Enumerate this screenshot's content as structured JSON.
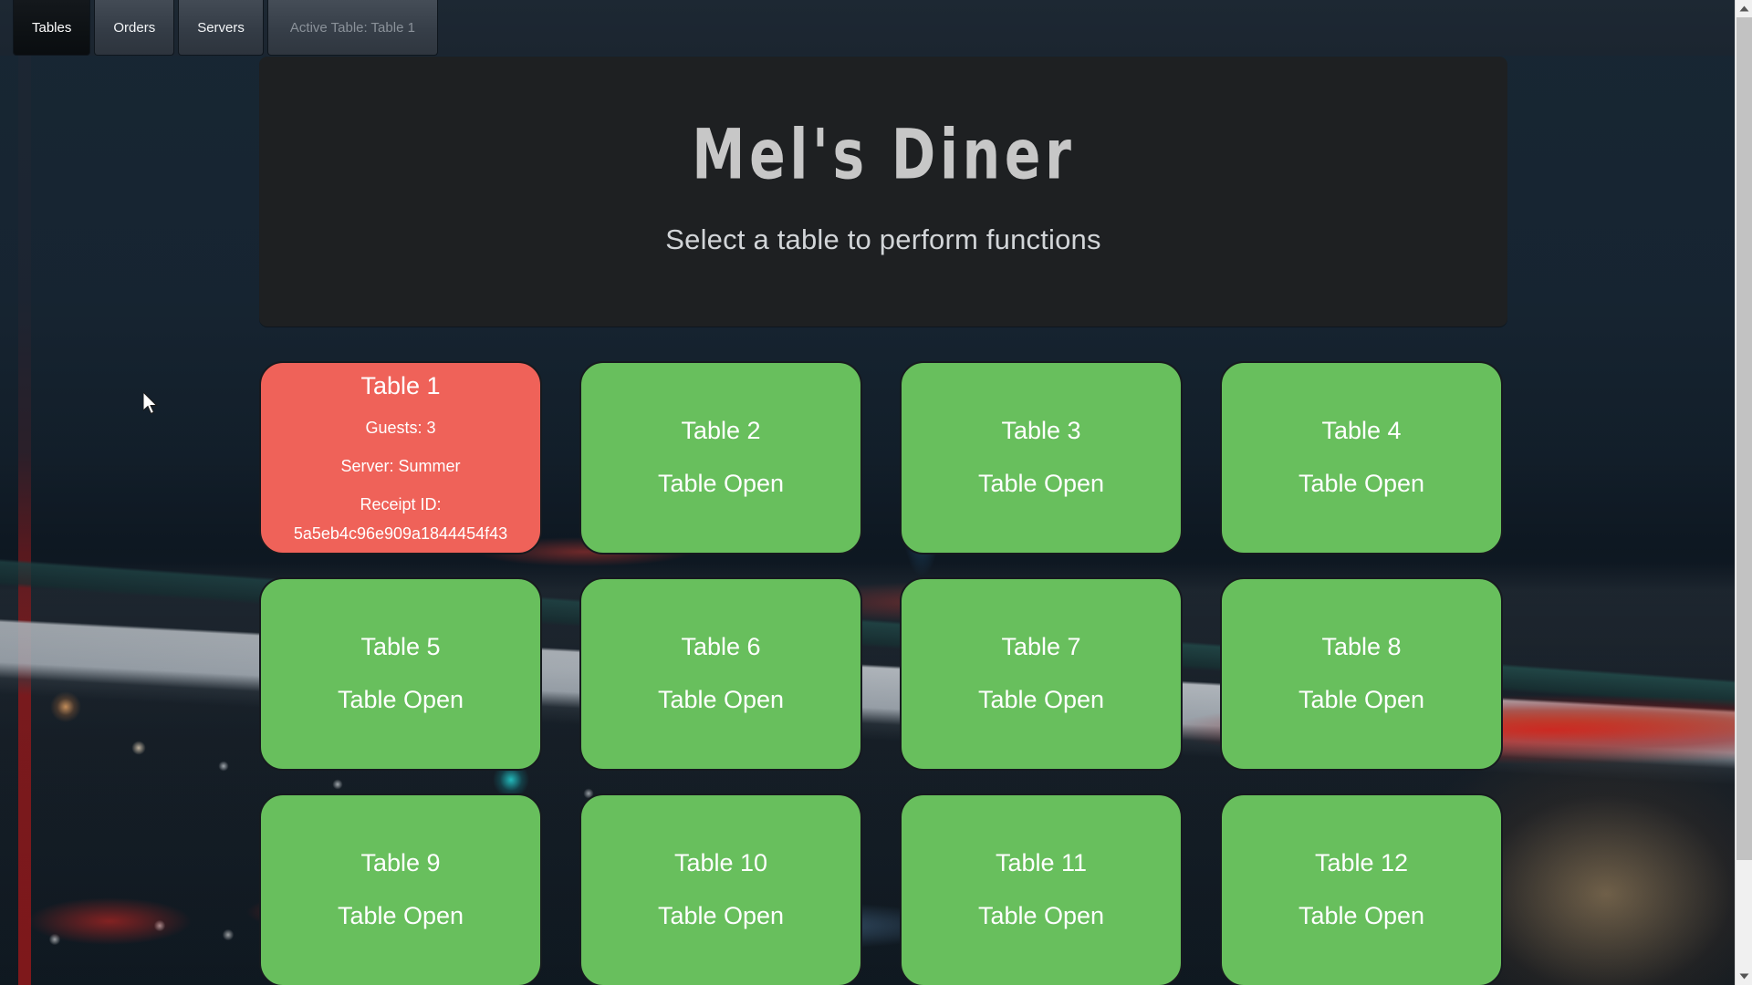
{
  "window": {
    "background_image_description": "night-time diner storefront street scene",
    "scrollbar": {
      "up_arrow_icon": "chevron-up-icon",
      "down_arrow_icon": "chevron-down-icon"
    }
  },
  "tabs": [
    {
      "label": "Tables",
      "state": "active"
    },
    {
      "label": "Orders",
      "state": "inactive"
    },
    {
      "label": "Servers",
      "state": "inactive"
    },
    {
      "label": "Active Table: Table 1",
      "state": "disabled"
    }
  ],
  "header": {
    "title": "Mel's Diner",
    "subtitle": "Select a table to perform functions",
    "title_color": "#c7c7c7",
    "panel_color": "#1e2022"
  },
  "colors": {
    "table_open": "#68bf5d",
    "table_seated": "#ef6259",
    "card_border": "#161a1f",
    "tab_active_bg": "#0d1114",
    "tab_inactive_bg": "#3a424c"
  },
  "labels": {
    "status_open": "Table Open",
    "guests_prefix": "Guests: ",
    "server_prefix": "Server: ",
    "receipt_label": "Receipt ID:"
  },
  "tables": [
    {
      "name": "Table 1",
      "status": "seated",
      "status_text": "",
      "guests": "Guests: 3",
      "server": "Server: Summer",
      "receipt_label": "Receipt ID:",
      "receipt_id": "5a5eb4c96e909a1844454f43"
    },
    {
      "name": "Table 2",
      "status": "open",
      "status_text": "Table Open"
    },
    {
      "name": "Table 3",
      "status": "open",
      "status_text": "Table Open"
    },
    {
      "name": "Table 4",
      "status": "open",
      "status_text": "Table Open"
    },
    {
      "name": "Table 5",
      "status": "open",
      "status_text": "Table Open"
    },
    {
      "name": "Table 6",
      "status": "open",
      "status_text": "Table Open"
    },
    {
      "name": "Table 7",
      "status": "open",
      "status_text": "Table Open"
    },
    {
      "name": "Table 8",
      "status": "open",
      "status_text": "Table Open"
    },
    {
      "name": "Table 9",
      "status": "open",
      "status_text": "Table Open"
    },
    {
      "name": "Table 10",
      "status": "open",
      "status_text": "Table Open"
    },
    {
      "name": "Table 11",
      "status": "open",
      "status_text": "Table Open"
    },
    {
      "name": "Table 12",
      "status": "open",
      "status_text": "Table Open"
    }
  ]
}
